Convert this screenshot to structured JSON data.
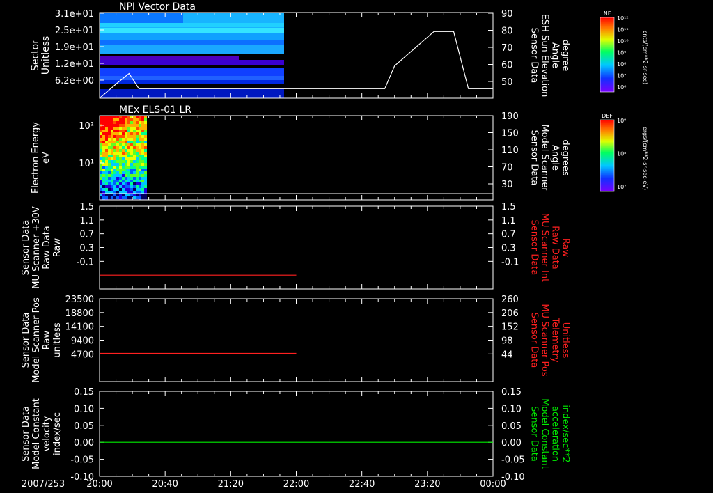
{
  "colors": {
    "background": "#000000",
    "axis": "#ffffff",
    "red_trace": "#ff2020",
    "green_trace": "#00ee00"
  },
  "date_label": "2007/253",
  "time_ticks": [
    "20:00",
    "20:40",
    "21:20",
    "22:00",
    "22:40",
    "23:20",
    "00:00"
  ],
  "panels": [
    {
      "title": "NPI Vector Data",
      "left_label": [
        "Sector",
        "Unitless"
      ],
      "left_ticks": [
        "3.1e+01",
        "2.5e+01",
        "1.9e+01",
        "1.2e+01",
        "6.2e+00"
      ],
      "right_label": [
        "Sensor Data",
        "ESH Sun Elevation",
        "Angle",
        "degree"
      ],
      "right_ticks": [
        "90",
        "80",
        "70",
        "60",
        "50"
      ],
      "right_label_color": "white"
    },
    {
      "title": "MEx ELS-01 LR",
      "left_label": [
        "Electron Energy",
        "eV"
      ],
      "left_ticks": [
        "10²",
        "10¹"
      ],
      "right_label": [
        "Sensor Data",
        "Model Scanner",
        "Angle",
        "degrees"
      ],
      "right_ticks": [
        "190",
        "150",
        "110",
        "70",
        "30"
      ],
      "right_label_color": "white"
    },
    {
      "title": "",
      "left_label": [
        "Sensor Data",
        "MU Scanner +30V",
        "Raw Data",
        "Raw"
      ],
      "left_ticks": [
        "1.5",
        "1.1",
        "0.7",
        "0.3",
        "-0.1"
      ],
      "right_label": [
        "Sensor Data",
        "MU Scanner Int",
        "Raw Data",
        "Raw"
      ],
      "right_ticks": [
        "1.5",
        "1.1",
        "0.7",
        "0.3",
        "-0.1"
      ],
      "right_label_color": "red"
    },
    {
      "title": "",
      "left_label": [
        "Sensor Data",
        "Model Scanner Pos",
        "Raw",
        "unitless"
      ],
      "left_ticks": [
        "23500",
        "18800",
        "14100",
        "9400",
        "4700"
      ],
      "right_label": [
        "Sensor Data",
        "MU Scanner Pos",
        "Telemetry",
        "Unitless"
      ],
      "right_ticks": [
        "260",
        "206",
        "152",
        "98",
        "44"
      ],
      "right_label_color": "red"
    },
    {
      "title": "",
      "left_label": [
        "Sensor Data",
        "Model Constant",
        "velocity",
        "index/sec"
      ],
      "left_ticks": [
        "0.15",
        "0.10",
        "0.05",
        "0.00",
        "-0.05",
        "-0.10"
      ],
      "right_label": [
        "Sensor Data",
        "Model Constant",
        "acceleration",
        "index/sec**2"
      ],
      "right_ticks": [
        "0.15",
        "0.10",
        "0.05",
        "0.00",
        "-0.05",
        "-0.10"
      ],
      "right_label_color": "green"
    }
  ],
  "colorbars": [
    {
      "tag": "NF",
      "top_label": "10¹²",
      "labels": [
        "10¹¹",
        "10¹⁰",
        "10⁹",
        "10⁸",
        "10⁷",
        "10⁶"
      ],
      "unit": "cnts/(cm**2-sr-sec)"
    },
    {
      "tag": "DEF",
      "top_label": "10⁹",
      "labels": [
        "10⁸",
        "10⁷"
      ],
      "unit": "ergs/(cm**2-sr-sec-eV)"
    }
  ],
  "chart_data": [
    {
      "type": "heatmap",
      "title": "NPI Vector Data",
      "x_range": [
        "20:00",
        "00:00"
      ],
      "data_extent": [
        "20:00",
        "21:55"
      ],
      "ylabel": "Sector Unitless",
      "overlay": {
        "type": "line",
        "name": "ESH Sun Elevation Angle",
        "ylim": [
          45,
          90
        ],
        "x_hours": [
          0,
          0.18,
          0.3,
          0.4,
          0.5,
          2.4,
          2.9,
          3.0,
          3.4,
          3.55,
          3.6,
          3.75,
          4.0
        ],
        "y": [
          45,
          53,
          58,
          50,
          50,
          50,
          50,
          62,
          80,
          80,
          80,
          50,
          50
        ]
      }
    },
    {
      "type": "heatmap",
      "title": "MEx ELS-01 LR",
      "x_range": [
        "20:00",
        "00:00"
      ],
      "data_extent": [
        "20:00",
        "20:15"
      ],
      "ylabel": "Electron Energy eV",
      "overlay": {
        "type": "line",
        "name": "Model Scanner Angle",
        "ylim": [
          0,
          190
        ],
        "x_hours": [
          0,
          4.0
        ],
        "y": [
          14,
          14
        ]
      }
    },
    {
      "type": "line",
      "series": [
        {
          "color": "#ff2020",
          "x_hours": [
            0,
            2.0
          ],
          "y": [
            0.0,
            0.0
          ]
        }
      ],
      "ylim": [
        -0.3,
        1.5
      ]
    },
    {
      "type": "line",
      "series": [
        {
          "color": "#ff2020",
          "x_hours": [
            0,
            2.0
          ],
          "y": [
            8000,
            8000
          ]
        }
      ],
      "ylim": [
        0,
        23500
      ]
    },
    {
      "type": "line",
      "series": [
        {
          "color": "#00ee00",
          "x_hours": [
            0,
            4.0
          ],
          "y": [
            0.0,
            0.0
          ]
        }
      ],
      "ylim": [
        -0.1,
        0.15
      ]
    }
  ]
}
